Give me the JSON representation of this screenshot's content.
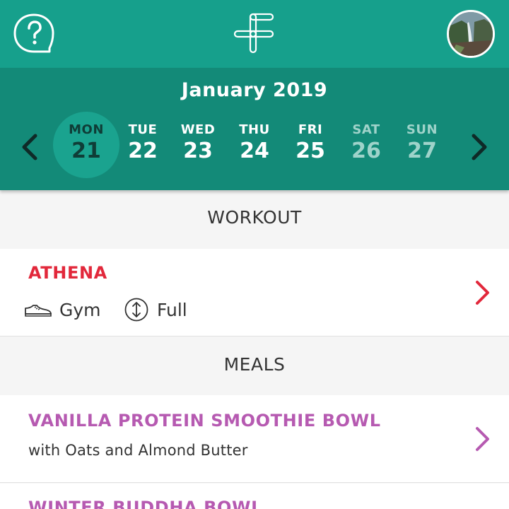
{
  "topbar": {
    "help_icon": "question-bubble-icon",
    "logo_icon": "brand-logo-icon",
    "avatar_icon": "waterfall-avatar-icon",
    "bg_color": "#16a08c"
  },
  "calendar": {
    "month": "January 2019",
    "prev_icon": "chevron-left-icon",
    "next_icon": "chevron-right-icon",
    "days": [
      {
        "name": "MON",
        "num": "21",
        "selected": true
      },
      {
        "name": "TUE",
        "num": "22"
      },
      {
        "name": "WED",
        "num": "23"
      },
      {
        "name": "THU",
        "num": "24"
      },
      {
        "name": "FRI",
        "num": "25"
      },
      {
        "name": "SAT",
        "num": "26",
        "weekend": true
      },
      {
        "name": "SUN",
        "num": "27",
        "weekend": true
      }
    ],
    "bg_color": "#138a78"
  },
  "workout": {
    "section_title": "WORKOUT",
    "title": "ATHENA",
    "location_icon": "sneaker-icon",
    "location": "Gym",
    "type_icon": "up-down-arrows-icon",
    "type": "Full",
    "title_color": "#e2283b"
  },
  "meals": {
    "section_title": "MEALS",
    "items": [
      {
        "title": "VANILLA PROTEIN SMOOTHIE BOWL",
        "subtitle": "with Oats and Almond Butter"
      },
      {
        "title": "WINTER BUDDHA BOWL"
      }
    ],
    "title_color": "#b65ab1"
  }
}
